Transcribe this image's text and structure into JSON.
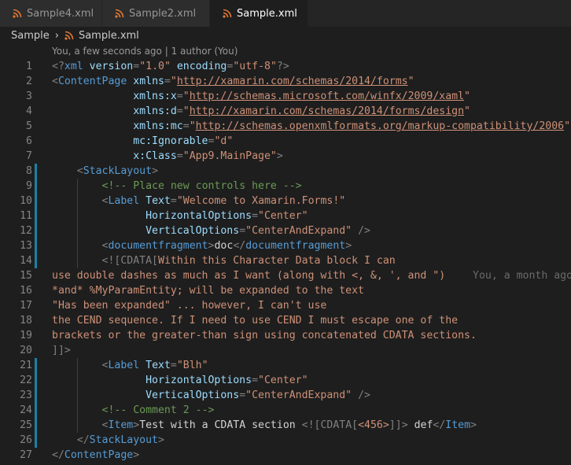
{
  "tabs": [
    {
      "label": "Sample4.xml",
      "active": false,
      "dirty": false
    },
    {
      "label": "Sample2.xml",
      "active": false,
      "dirty": false
    },
    {
      "label": "Sample.xml",
      "active": true,
      "dirty": true
    }
  ],
  "breadcrumb": {
    "folder": "Sample",
    "file": "Sample.xml"
  },
  "codelens": "You, a few seconds ago | 1 author (You)",
  "blame_annotation": "You, a month ago",
  "colors": {
    "tag": "#569cd6",
    "attr": "#9cdcfe",
    "string": "#ce9178",
    "comment": "#6a9955",
    "gutter_modified": "#1b81a8",
    "xml_icon": "#e37933"
  },
  "lines": [
    {
      "n": "1",
      "tokens": [
        [
          "p",
          "<?"
        ],
        [
          "tag",
          "xml"
        ],
        [
          "txt",
          " "
        ],
        [
          "attr",
          "version"
        ],
        [
          "p",
          "="
        ],
        [
          "str",
          "\"1.0\""
        ],
        [
          "txt",
          " "
        ],
        [
          "attr",
          "encoding"
        ],
        [
          "p",
          "="
        ],
        [
          "str",
          "\"utf-8\""
        ],
        [
          "p",
          "?>"
        ]
      ]
    },
    {
      "n": "2",
      "tokens": [
        [
          "p",
          "<"
        ],
        [
          "tag",
          "ContentPage"
        ],
        [
          "txt",
          " "
        ],
        [
          "attr",
          "xmlns"
        ],
        [
          "p",
          "="
        ],
        [
          "str",
          "\""
        ],
        [
          "url",
          "http://xamarin.com/schemas/2014/forms"
        ],
        [
          "str",
          "\""
        ]
      ]
    },
    {
      "n": "3",
      "tokens": [
        [
          "txt",
          "             "
        ],
        [
          "attr",
          "xmlns:x"
        ],
        [
          "p",
          "="
        ],
        [
          "str",
          "\""
        ],
        [
          "url",
          "http://schemas.microsoft.com/winfx/2009/xaml"
        ],
        [
          "str",
          "\""
        ]
      ]
    },
    {
      "n": "4",
      "tokens": [
        [
          "txt",
          "             "
        ],
        [
          "attr",
          "xmlns:d"
        ],
        [
          "p",
          "="
        ],
        [
          "str",
          "\""
        ],
        [
          "url",
          "http://xamarin.com/schemas/2014/forms/design"
        ],
        [
          "str",
          "\""
        ]
      ]
    },
    {
      "n": "5",
      "tokens": [
        [
          "txt",
          "             "
        ],
        [
          "attr",
          "xmlns:mc"
        ],
        [
          "p",
          "="
        ],
        [
          "str",
          "\""
        ],
        [
          "url",
          "http://schemas.openxmlformats.org/markup-compatibility/2006"
        ],
        [
          "str",
          "\""
        ]
      ]
    },
    {
      "n": "6",
      "tokens": [
        [
          "txt",
          "             "
        ],
        [
          "attr",
          "mc:Ignorable"
        ],
        [
          "p",
          "="
        ],
        [
          "str",
          "\"d\""
        ]
      ]
    },
    {
      "n": "7",
      "tokens": [
        [
          "txt",
          "             "
        ],
        [
          "attr",
          "x:Class"
        ],
        [
          "p",
          "="
        ],
        [
          "str",
          "\"App9.MainPage\""
        ],
        [
          "p",
          ">"
        ]
      ]
    },
    {
      "n": "8",
      "mod": true,
      "tokens": [
        [
          "txt",
          "    "
        ],
        [
          "p",
          "<"
        ],
        [
          "tag",
          "StackLayout"
        ],
        [
          "p",
          ">"
        ]
      ]
    },
    {
      "n": "9",
      "mod": true,
      "tokens": [
        [
          "txt",
          "        "
        ],
        [
          "com",
          "<!-- Place new controls here -->"
        ]
      ]
    },
    {
      "n": "10",
      "mod": true,
      "tokens": [
        [
          "txt",
          "        "
        ],
        [
          "p",
          "<"
        ],
        [
          "tag",
          "Label"
        ],
        [
          "txt",
          " "
        ],
        [
          "attr",
          "Text"
        ],
        [
          "p",
          "="
        ],
        [
          "str",
          "\"Welcome to Xamarin.Forms!\""
        ]
      ]
    },
    {
      "n": "11",
      "mod": true,
      "tokens": [
        [
          "txt",
          "               "
        ],
        [
          "attr",
          "HorizontalOptions"
        ],
        [
          "p",
          "="
        ],
        [
          "str",
          "\"Center\""
        ]
      ]
    },
    {
      "n": "12",
      "mod": true,
      "tokens": [
        [
          "txt",
          "               "
        ],
        [
          "attr",
          "VerticalOptions"
        ],
        [
          "p",
          "="
        ],
        [
          "str",
          "\"CenterAndExpand\""
        ],
        [
          "txt",
          " "
        ],
        [
          "p",
          "/>"
        ]
      ]
    },
    {
      "n": "13",
      "mod": true,
      "tokens": [
        [
          "txt",
          "        "
        ],
        [
          "p",
          "<"
        ],
        [
          "tag",
          "documentfragment"
        ],
        [
          "p",
          ">"
        ],
        [
          "txt",
          "doc"
        ],
        [
          "p",
          "</"
        ],
        [
          "tag",
          "documentfragment"
        ],
        [
          "p",
          ">"
        ]
      ]
    },
    {
      "n": "14",
      "mod": true,
      "tokens": [
        [
          "txt",
          "        "
        ],
        [
          "p",
          "<![CDATA["
        ],
        [
          "cd",
          "Within this Character Data block I can"
        ]
      ]
    },
    {
      "n": "15",
      "blame": true,
      "tokens": [
        [
          "cd",
          "use double dashes as much as I want (along with <, &, ', and \")"
        ]
      ]
    },
    {
      "n": "16",
      "tokens": [
        [
          "cd",
          "*and* %MyParamEntity; will be expanded to the text"
        ]
      ]
    },
    {
      "n": "17",
      "tokens": [
        [
          "cd",
          "\"Has been expanded\" ... however, I can't use"
        ]
      ]
    },
    {
      "n": "18",
      "tokens": [
        [
          "cd",
          "the CEND sequence. If I need to use CEND I must escape one of the"
        ]
      ]
    },
    {
      "n": "19",
      "tokens": [
        [
          "cd",
          "brackets or the greater-than sign using concatenated CDATA sections."
        ]
      ]
    },
    {
      "n": "20",
      "tokens": [
        [
          "p",
          "]]>"
        ]
      ]
    },
    {
      "n": "21",
      "mod": true,
      "tokens": [
        [
          "txt",
          "        "
        ],
        [
          "p",
          "<"
        ],
        [
          "tag",
          "Label"
        ],
        [
          "txt",
          " "
        ],
        [
          "attr",
          "Text"
        ],
        [
          "p",
          "="
        ],
        [
          "str",
          "\"Blh\""
        ]
      ]
    },
    {
      "n": "22",
      "mod": true,
      "tokens": [
        [
          "txt",
          "               "
        ],
        [
          "attr",
          "HorizontalOptions"
        ],
        [
          "p",
          "="
        ],
        [
          "str",
          "\"Center\""
        ]
      ]
    },
    {
      "n": "23",
      "mod": true,
      "tokens": [
        [
          "txt",
          "               "
        ],
        [
          "attr",
          "VerticalOptions"
        ],
        [
          "p",
          "="
        ],
        [
          "str",
          "\"CenterAndExpand\""
        ],
        [
          "txt",
          " "
        ],
        [
          "p",
          "/>"
        ]
      ]
    },
    {
      "n": "24",
      "mod": true,
      "tokens": [
        [
          "txt",
          "        "
        ],
        [
          "com",
          "<!-- Comment 2 -->"
        ]
      ]
    },
    {
      "n": "25",
      "mod": true,
      "tokens": [
        [
          "txt",
          "        "
        ],
        [
          "p",
          "<"
        ],
        [
          "tag",
          "Item"
        ],
        [
          "p",
          ">"
        ],
        [
          "txt",
          "Test with a CDATA section "
        ],
        [
          "p",
          "<![CDATA["
        ],
        [
          "cd",
          "<456>"
        ],
        [
          "p",
          "]]>"
        ],
        [
          "txt",
          " def"
        ],
        [
          "p",
          "</"
        ],
        [
          "tag",
          "Item"
        ],
        [
          "p",
          ">"
        ]
      ]
    },
    {
      "n": "26",
      "mod": true,
      "tokens": [
        [
          "txt",
          "    "
        ],
        [
          "p",
          "</"
        ],
        [
          "tag",
          "StackLayout"
        ],
        [
          "p",
          ">"
        ]
      ]
    },
    {
      "n": "27",
      "tokens": [
        [
          "p",
          "</"
        ],
        [
          "tag",
          "ContentPage"
        ],
        [
          "p",
          ">"
        ]
      ]
    }
  ]
}
